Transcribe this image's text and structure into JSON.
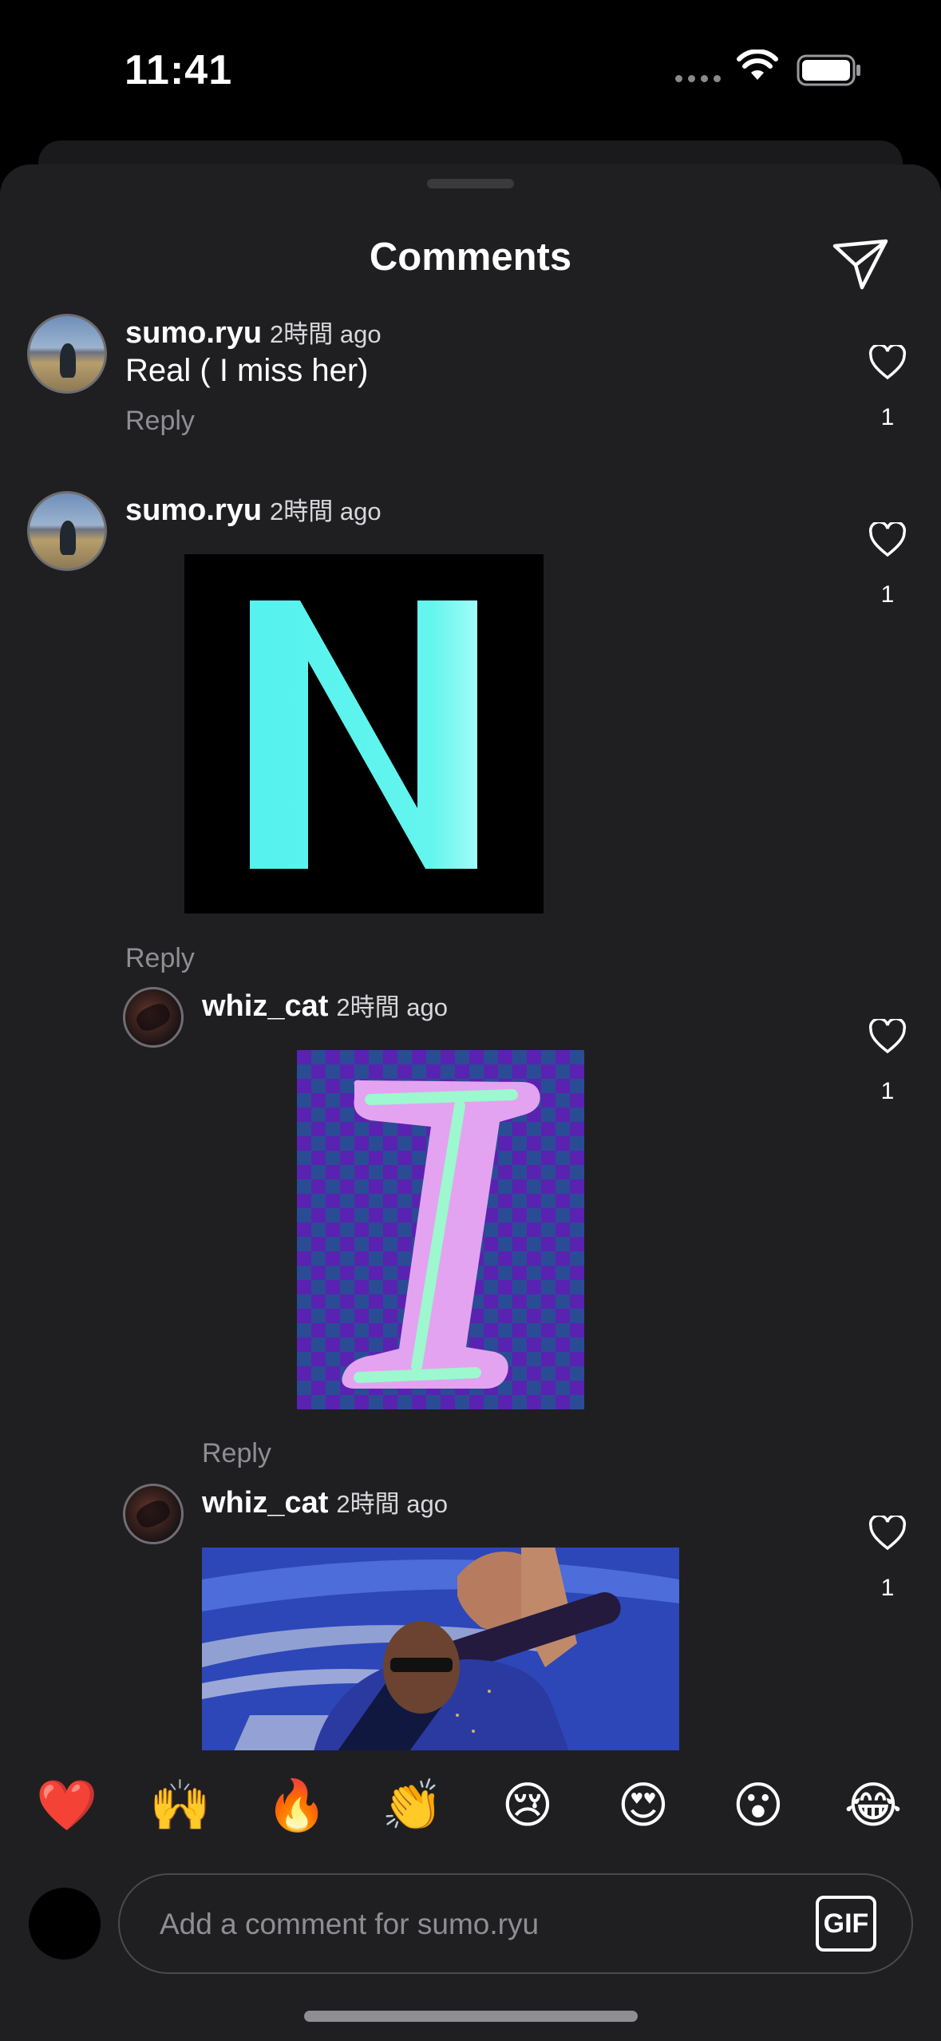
{
  "status_bar": {
    "time": "11:41"
  },
  "sheet": {
    "title": "Comments"
  },
  "comments": [
    {
      "username": "sumo.ryu",
      "timestamp": "2時間 ago",
      "text": "Real ( I miss her)",
      "reply_label": "Reply",
      "likes": "1"
    },
    {
      "username": "sumo.ryu",
      "timestamp": "2時間 ago",
      "image": "letter-n-sticker",
      "reply_label": "Reply",
      "likes": "1"
    },
    {
      "username": "whiz_cat",
      "timestamp": "2時間 ago",
      "image": "letter-i-sticker",
      "reply_label": "Reply",
      "likes": "1"
    },
    {
      "username": "whiz_cat",
      "timestamp": "2時間 ago",
      "image": "waving-man-gif",
      "likes": "1"
    }
  ],
  "quick_reactions": [
    "❤️",
    "🙌",
    "🔥",
    "👏",
    "😢",
    "😍",
    "😮",
    "😂"
  ],
  "composer": {
    "placeholder": "Add a comment for sumo.ryu",
    "gif_label": "GIF"
  },
  "colors": {
    "background": "#000000",
    "sheet": "#1f1f21",
    "muted_text": "#8e8e93",
    "n_letter": "#5cf5ee",
    "i_letter": "#e3a3f0"
  }
}
